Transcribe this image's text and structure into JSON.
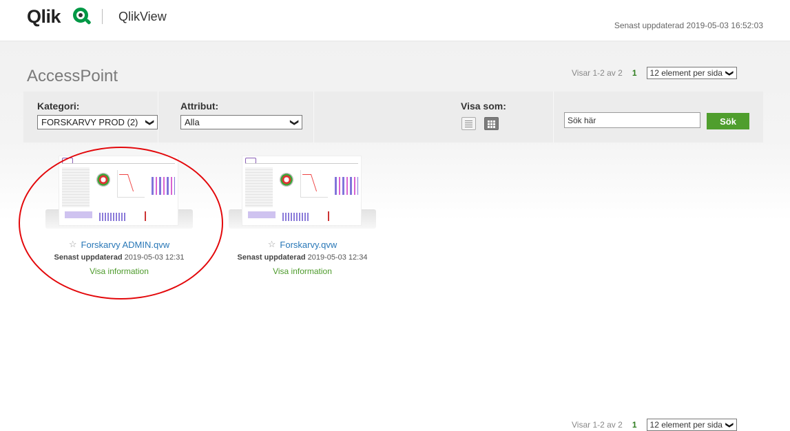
{
  "header": {
    "brand": "Qlik",
    "product": "QlikView",
    "last_updated": "Senast uppdaterad 2019-05-03 16:52:03"
  },
  "page_title": "AccessPoint",
  "paging": {
    "showing": "Visar 1-2 av 2",
    "page": "1",
    "per_page": "12 element per sida"
  },
  "filters": {
    "category_label": "Kategori:",
    "category_value": "FORSKARVY PROD (2)",
    "attribute_label": "Attribut:",
    "attribute_value": "Alla",
    "view_label": "Visa som:",
    "search_value": "Sök här",
    "search_button": "Sök"
  },
  "documents": [
    {
      "name": "Forskarvy ADMIN.qvw",
      "updated_label": "Senast uppdaterad",
      "updated_value": "2019-05-03 12:31",
      "info_link": "Visa information"
    },
    {
      "name": "Forskarvy.qvw",
      "updated_label": "Senast uppdaterad",
      "updated_value": "2019-05-03 12:34",
      "info_link": "Visa information"
    }
  ],
  "colors": {
    "accent_green": "#4f9e2d",
    "link_blue": "#2877b7",
    "annotation_red": "#e3080b"
  }
}
